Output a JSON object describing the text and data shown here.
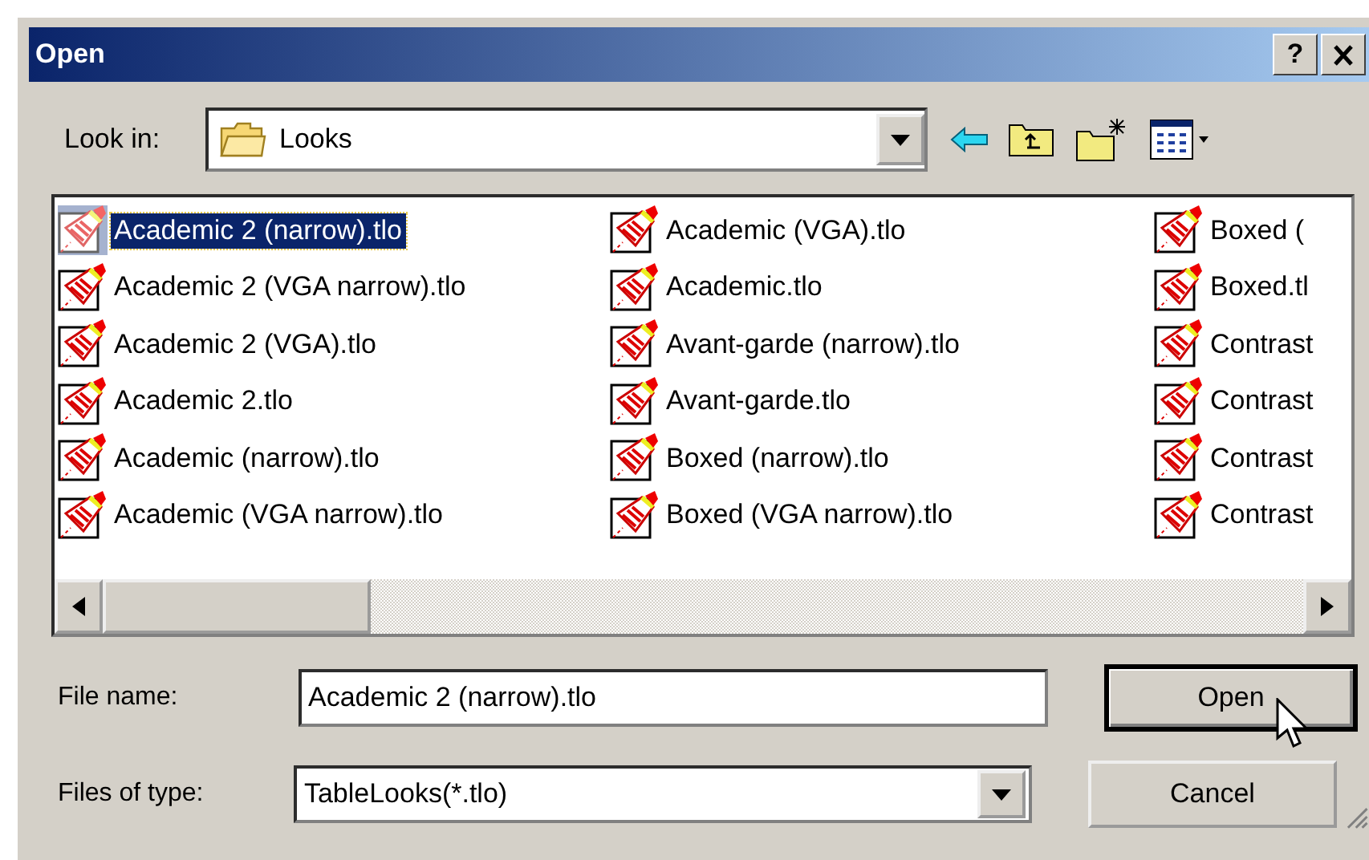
{
  "window": {
    "title": "Open",
    "help_button": "?"
  },
  "look_in": {
    "label": "Look in:",
    "value": "Looks"
  },
  "files": [
    {
      "name": "Academic 2 (narrow).tlo",
      "selected": true
    },
    {
      "name": "Academic 2 (VGA narrow).tlo",
      "selected": false
    },
    {
      "name": "Academic 2 (VGA).tlo",
      "selected": false
    },
    {
      "name": "Academic 2.tlo",
      "selected": false
    },
    {
      "name": "Academic (narrow).tlo",
      "selected": false
    },
    {
      "name": "Academic (VGA narrow).tlo",
      "selected": false
    },
    {
      "name": "Academic (VGA).tlo",
      "selected": false
    },
    {
      "name": "Academic.tlo",
      "selected": false
    },
    {
      "name": "Avant-garde (narrow).tlo",
      "selected": false
    },
    {
      "name": "Avant-garde.tlo",
      "selected": false
    },
    {
      "name": "Boxed (narrow).tlo",
      "selected": false
    },
    {
      "name": "Boxed (VGA narrow).tlo",
      "selected": false
    },
    {
      "name": "Boxed (",
      "selected": false
    },
    {
      "name": "Boxed.tl",
      "selected": false
    },
    {
      "name": "Contrast",
      "selected": false
    },
    {
      "name": "Contrast",
      "selected": false
    },
    {
      "name": "Contrast",
      "selected": false
    },
    {
      "name": "Contrast",
      "selected": false
    }
  ],
  "file_name": {
    "label": "File name:",
    "value": "Academic 2 (narrow).tlo"
  },
  "files_of_type": {
    "label": "Files of type:",
    "value": "TableLooks(*.tlo)"
  },
  "buttons": [
    {
      "label": "Open",
      "default": true
    },
    {
      "label": "Cancel",
      "default": false
    }
  ]
}
